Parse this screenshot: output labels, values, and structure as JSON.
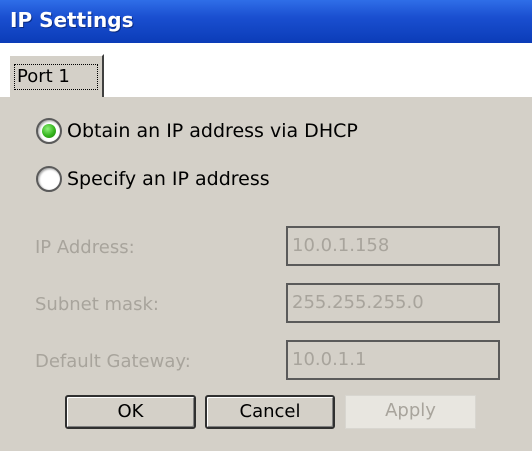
{
  "window": {
    "title": "IP Settings"
  },
  "tabs": [
    {
      "label": "Port 1",
      "selected": true
    }
  ],
  "ip_mode": {
    "options": [
      {
        "label": "Obtain an IP address via DHCP",
        "selected": true
      },
      {
        "label": "Specify an IP address",
        "selected": false
      }
    ]
  },
  "fields": {
    "ip_address": {
      "label": "IP Address:",
      "value": "10.0.1.158",
      "enabled": false
    },
    "subnet_mask": {
      "label": "Subnet mask:",
      "value": "255.255.255.0",
      "enabled": false
    },
    "default_gateway": {
      "label": "Default Gateway:",
      "value": "10.0.1.1",
      "enabled": false
    }
  },
  "buttons": {
    "ok": {
      "label": "OK",
      "enabled": true
    },
    "cancel": {
      "label": "Cancel",
      "enabled": true
    },
    "apply": {
      "label": "Apply",
      "enabled": false
    }
  },
  "colors": {
    "title_bar": "#1a4fd0",
    "panel_background": "#d4d0c8",
    "radio_selected": "#35b51e",
    "disabled_text": "#a8a49c"
  }
}
